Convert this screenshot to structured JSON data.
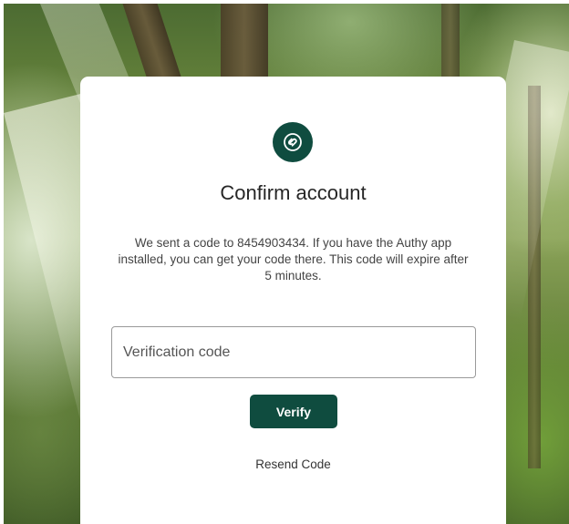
{
  "card": {
    "logo_icon": "authy-logo-icon",
    "title": "Confirm account",
    "description": "We sent a code to 8454903434. If you have the Authy app installed, you can get your code there. This code will expire after 5 minutes.",
    "code_input": {
      "value": "",
      "placeholder": "Verification code"
    },
    "verify_label": "Verify",
    "resend_label": "Resend Code"
  },
  "colors": {
    "brand": "#0f4c3f",
    "text": "#262626",
    "card_bg": "#ffffff"
  }
}
